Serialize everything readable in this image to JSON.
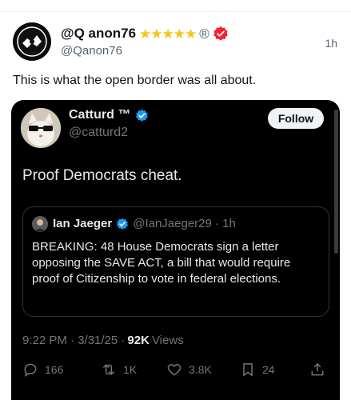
{
  "post": {
    "display_name": "@Q anon76",
    "stars": "★★★★★",
    "registered": "®",
    "handle": "@Qanon76",
    "time": "1h",
    "text": "This is what the open border was all about."
  },
  "embed": {
    "display_name": "Catturd ™",
    "handle": "@catturd2",
    "follow_label": "Follow",
    "text": "Proof Democrats cheat.",
    "quote": {
      "display_name": "Ian Jaeger",
      "handle_time": "@IanJaeger29 · 1h",
      "text": "BREAKING: 48 House Democrats sign a letter opposing the SAVE ACT, a bill that would require proof of Citizenship to vote in federal elections."
    },
    "meta": {
      "time_date": "9:22 PM · 3/31/25 · ",
      "views_count": "92K",
      "views_label": "Views"
    },
    "actions": {
      "replies": "166",
      "reposts": "1K",
      "likes": "3.8K",
      "bookmarks": "24"
    }
  },
  "colors": {
    "accent_blue": "#1d9bf0",
    "verified_red": "#f4212e",
    "star_gold": "#f5c518"
  },
  "icons": [
    "verified-badge-icon",
    "reply-icon",
    "repost-icon",
    "like-icon",
    "bookmark-icon",
    "share-icon"
  ]
}
